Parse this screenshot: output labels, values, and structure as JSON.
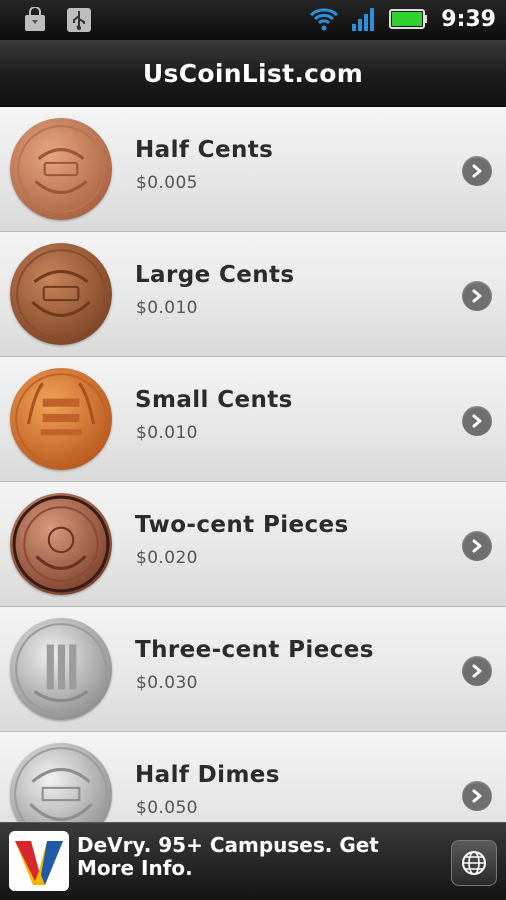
{
  "status_bar": {
    "time": "9:39",
    "icons": [
      "shopping-bag-icon",
      "usb-icon",
      "wifi-icon",
      "signal-icon",
      "battery-icon"
    ],
    "battery_color": "#2fd12f",
    "signal_color": "#2b8fd9"
  },
  "title_bar": {
    "title": "UsCoinList.com"
  },
  "coins": [
    {
      "name": "Half Cents",
      "price": "$0.005",
      "icon": "half-cent-coin-icon",
      "color": "#c9845a"
    },
    {
      "name": "Large Cents",
      "price": "$0.010",
      "icon": "large-cent-coin-icon",
      "color": "#a0603a"
    },
    {
      "name": "Small Cents",
      "price": "$0.010",
      "icon": "small-cent-coin-icon",
      "color": "#d8742c"
    },
    {
      "name": "Two-cent Pieces",
      "price": "$0.020",
      "icon": "two-cent-coin-icon",
      "color": "#b0694a"
    },
    {
      "name": "Three-cent Pieces",
      "price": "$0.030",
      "icon": "three-cent-coin-icon",
      "color": "#b9b9b9"
    },
    {
      "name": "Half Dimes",
      "price": "$0.050",
      "icon": "half-dime-coin-icon",
      "color": "#c4c4c4"
    }
  ],
  "ad": {
    "text": "DeVry. 95+ Campuses. Get More Info.",
    "logo_icon": "devry-logo-icon",
    "action_icon": "globe-icon"
  }
}
